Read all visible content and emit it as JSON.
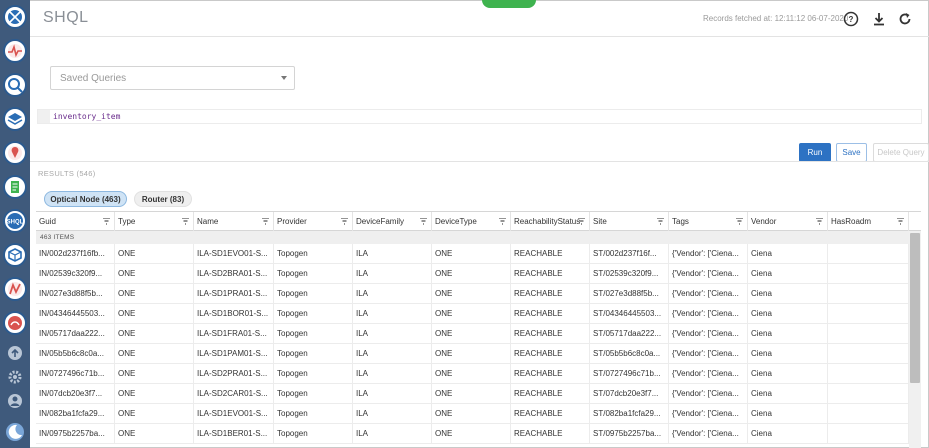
{
  "header": {
    "title": "SHQL",
    "fetched": "Records fetched at: 12:11:12 06-07-2020"
  },
  "sidebar": {
    "items": [
      {
        "icon": "network-globe-icon",
        "color": "#2a6db5"
      },
      {
        "icon": "pulse-monitor-icon",
        "color": "#d9534f"
      },
      {
        "icon": "cube-search-icon",
        "color": "#2a6db5"
      },
      {
        "icon": "layers-icon",
        "color": "#2a6db5"
      },
      {
        "icon": "map-pin-icon",
        "color": "#d9534f"
      },
      {
        "icon": "document-icon",
        "color": "#3fb34f"
      },
      {
        "icon": "shql-icon",
        "color": "#2a6db5",
        "label": "SHQL"
      },
      {
        "icon": "box-icon",
        "color": "#2a6db5"
      },
      {
        "icon": "chart-icon",
        "color": "#d9534f"
      },
      {
        "icon": "signal-icon",
        "color": "#d9534f"
      }
    ],
    "bottom": [
      "upload-icon",
      "settings-icon",
      "user-icon",
      "moon-icon"
    ]
  },
  "toolbar": {
    "saved_queries_placeholder": "Saved Queries",
    "query_text": "inventory_item",
    "run_label": "Run",
    "save_label": "Save",
    "delete_label": "Delete Query"
  },
  "results": {
    "label": "RESULTS (546)",
    "tabs": [
      {
        "label": "Optical Node (463)",
        "active": true
      },
      {
        "label": "Router (83)",
        "active": false
      }
    ],
    "group_label": "463 ITEMS",
    "columns": [
      "Guid",
      "Type",
      "Name",
      "Provider",
      "DeviceFamily",
      "DeviceType",
      "ReachabilityStatus",
      "Site",
      "Tags",
      "Vendor",
      "HasRoadm"
    ],
    "rows": [
      [
        "IN/002d237f16fb...",
        "ONE",
        "ILA-SD1EVO01-S...",
        "Topogen",
        "ILA",
        "ONE",
        "REACHABLE",
        "ST/002d237f16f...",
        "{'Vendor': ['Ciena...",
        "Ciena",
        ""
      ],
      [
        "IN/02539c320f9...",
        "ONE",
        "ILA-SD2BRA01-S...",
        "Topogen",
        "ILA",
        "ONE",
        "REACHABLE",
        "ST/02539c320f9...",
        "{'Vendor': ['Ciena...",
        "Ciena",
        ""
      ],
      [
        "IN/027e3d88f5b...",
        "ONE",
        "ILA-SD1PRA01-S...",
        "Topogen",
        "ILA",
        "ONE",
        "REACHABLE",
        "ST/027e3d88f5b...",
        "{'Vendor': ['Ciena...",
        "Ciena",
        ""
      ],
      [
        "IN/04346445503...",
        "ONE",
        "ILA-SD1BOR01-S...",
        "Topogen",
        "ILA",
        "ONE",
        "REACHABLE",
        "ST/04346445503...",
        "{'Vendor': ['Ciena...",
        "Ciena",
        ""
      ],
      [
        "IN/05717daa222...",
        "ONE",
        "ILA-SD1FRA01-S...",
        "Topogen",
        "ILA",
        "ONE",
        "REACHABLE",
        "ST/05717daa222...",
        "{'Vendor': ['Ciena...",
        "Ciena",
        ""
      ],
      [
        "IN/05b5b6c8c0a...",
        "ONE",
        "ILA-SD1PAM01-S...",
        "Topogen",
        "ILA",
        "ONE",
        "REACHABLE",
        "ST/05b5b6c8c0a...",
        "{'Vendor': ['Ciena...",
        "Ciena",
        ""
      ],
      [
        "IN/0727496c71b...",
        "ONE",
        "ILA-SD2PRA01-S...",
        "Topogen",
        "ILA",
        "ONE",
        "REACHABLE",
        "ST/0727496c71b...",
        "{'Vendor': ['Ciena...",
        "Ciena",
        ""
      ],
      [
        "IN/07dcb20e3f7...",
        "ONE",
        "ILA-SD2CAR01-S...",
        "Topogen",
        "ILA",
        "ONE",
        "REACHABLE",
        "ST/07dcb20e3f7...",
        "{'Vendor': ['Ciena...",
        "Ciena",
        ""
      ],
      [
        "IN/082ba1fcfa29...",
        "ONE",
        "ILA-SD1EVO01-S...",
        "Topogen",
        "ILA",
        "ONE",
        "REACHABLE",
        "ST/082ba1fcfa29...",
        "{'Vendor': ['Ciena...",
        "Ciena",
        ""
      ],
      [
        "IN/0975b2257ba...",
        "ONE",
        "ILA-SD1BER01-S...",
        "Topogen",
        "ILA",
        "ONE",
        "REACHABLE",
        "ST/0975b2257ba...",
        "{'Vendor': ['Ciena...",
        "Ciena",
        ""
      ]
    ]
  }
}
